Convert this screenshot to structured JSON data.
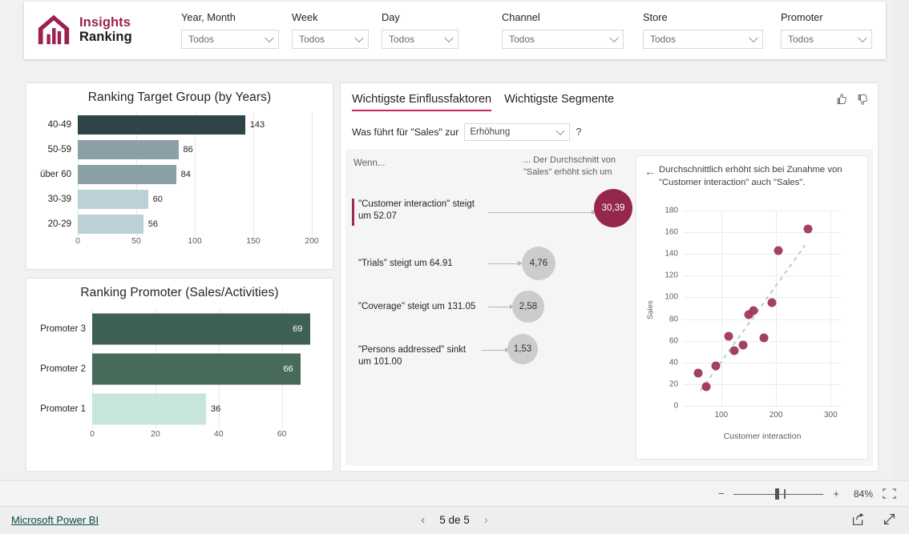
{
  "brand": {
    "line1": "Insights",
    "line2": "Ranking",
    "logo_icon": "insights-house-bars-logo",
    "color": "#9c2150"
  },
  "filters": [
    {
      "label": "Year, Month",
      "value": "Todos",
      "icon": "chevron-down-icon"
    },
    {
      "label": "Week",
      "value": "Todos",
      "icon": "chevron-down-icon"
    },
    {
      "label": "Day",
      "value": "Todos",
      "icon": "chevron-down-icon"
    },
    {
      "label": "Channel",
      "value": "Todos",
      "icon": "chevron-down-icon"
    },
    {
      "label": "Store",
      "value": "Todos",
      "icon": "chevron-down-icon"
    },
    {
      "label": "Promoter",
      "value": "Todos",
      "icon": "chevron-down-icon"
    }
  ],
  "influencers": {
    "tabs": [
      {
        "label": "Wichtigste Einflussfaktoren",
        "active": true
      },
      {
        "label": "Wichtigste Segmente",
        "active": false
      }
    ],
    "feedback": [
      {
        "icon": "thumbs-up-icon"
      },
      {
        "icon": "thumbs-down-icon"
      }
    ],
    "question_prefix": "Was führt für \"Sales\" zur",
    "question_value": "Erhöhung",
    "question_help": "?",
    "col_left_header": "Wenn...",
    "col_right_header": "... Der Durchschnitt von \"Sales\" erhöht sich um",
    "rows": [
      {
        "label": "\"Customer interaction\" steigt um 52.07",
        "bubble": "30,39",
        "selected": true
      },
      {
        "label": "\"Trials\" steigt um 64.91",
        "bubble": "4,76",
        "selected": false
      },
      {
        "label": "\"Coverage\" steigt um 131.05",
        "bubble": "2,58",
        "selected": false
      },
      {
        "label": "\"Persons addressed\" sinkt um 101.00",
        "bubble": "1,53",
        "selected": false
      }
    ],
    "detail": {
      "back_icon": "arrow-left-icon",
      "caption": "Durchschnittlich erhöht sich bei Zunahme von \"Customer interaction\" auch \"Sales\"."
    }
  },
  "chart_data": [
    {
      "type": "bar",
      "title": "Ranking Target Group (by Years)",
      "orientation": "horizontal",
      "categories": [
        "40-49",
        "50-59",
        "über 60",
        "30-39",
        "20-29"
      ],
      "values": [
        143,
        86,
        84,
        60,
        56
      ],
      "colors": [
        "#2f4448",
        "#8ba0a6",
        "#8ba0a6",
        "#bcd0d8",
        "#bcd0d8"
      ],
      "xlabel": "",
      "ylabel": "",
      "xlim": [
        0,
        200
      ],
      "xticks": [
        0,
        50,
        100,
        150,
        200
      ],
      "grid": true,
      "labels_inside": false
    },
    {
      "type": "bar",
      "title": "Ranking Promoter (Sales/Activities)",
      "orientation": "horizontal",
      "categories": [
        "Promoter 3",
        "Promoter 2",
        "Promoter 1"
      ],
      "values": [
        69,
        66,
        36
      ],
      "colors": [
        "#3d6152",
        "#476a5a",
        "#c8e5db"
      ],
      "label_inside": [
        true,
        true,
        false
      ],
      "xlabel": "",
      "ylabel": "",
      "xlim": [
        0,
        72
      ],
      "xticks": [
        0,
        20,
        40,
        60
      ],
      "grid": true
    },
    {
      "type": "scatter",
      "title": "",
      "xlabel": "Customer interaction",
      "ylabel": "Sales",
      "xlim": [
        30,
        320
      ],
      "ylim": [
        0,
        180
      ],
      "xticks": [
        100,
        200,
        300
      ],
      "yticks": [
        0,
        20,
        40,
        60,
        80,
        100,
        120,
        140,
        160,
        180
      ],
      "point_color": "#9d2f57",
      "trendline": {
        "style": "dashed",
        "color": "#b9cdd2",
        "x": [
          62,
          253
        ],
        "y": [
          14,
          148
        ]
      },
      "points": [
        {
          "x": 58,
          "y": 30
        },
        {
          "x": 72,
          "y": 18
        },
        {
          "x": 90,
          "y": 37
        },
        {
          "x": 113,
          "y": 64
        },
        {
          "x": 124,
          "y": 51
        },
        {
          "x": 140,
          "y": 56
        },
        {
          "x": 150,
          "y": 84
        },
        {
          "x": 159,
          "y": 88
        },
        {
          "x": 178,
          "y": 63
        },
        {
          "x": 192,
          "y": 95
        },
        {
          "x": 204,
          "y": 143
        },
        {
          "x": 258,
          "y": 163
        }
      ]
    }
  ],
  "zoombar": {
    "minus": "−",
    "plus": "+",
    "percent": "84%",
    "fit_icon": "fit-to-page-icon"
  },
  "footer": {
    "link": "Microsoft Power BI",
    "prev_icon": "chevron-left-icon",
    "next_icon": "chevron-right-icon",
    "page_text": "5 de 5",
    "actions": [
      {
        "icon": "share-icon"
      },
      {
        "icon": "fullscreen-icon"
      }
    ]
  }
}
